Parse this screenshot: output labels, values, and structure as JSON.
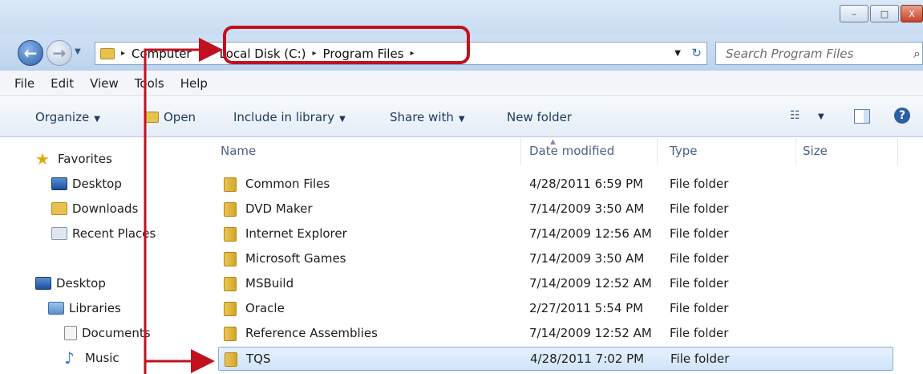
{
  "window": {
    "minimize_glyph": "–",
    "maximize_glyph": "□",
    "close_glyph": "X"
  },
  "address": {
    "crumbs": [
      "Computer",
      "Local Disk (C:)",
      "Program Files"
    ],
    "separator": "▸",
    "dropdown_glyph": "▼",
    "refresh_glyph": "↻"
  },
  "search": {
    "placeholder": "Search Program Files",
    "icon_glyph": "⌕"
  },
  "menubar": {
    "items": [
      "File",
      "Edit",
      "View",
      "Tools",
      "Help"
    ]
  },
  "toolbar": {
    "organize": "Organize",
    "open": "Open",
    "include_in_library": "Include in library",
    "share_with": "Share with",
    "new_folder": "New folder",
    "caret": "▼",
    "views_glyph": "☷",
    "help_glyph": "?"
  },
  "navpane": {
    "favorites_label": "Favorites",
    "star_glyph": "★",
    "music_glyph": "♪",
    "items": [
      {
        "label": "Desktop"
      },
      {
        "label": "Downloads"
      },
      {
        "label": "Recent Places"
      },
      {
        "label": "Desktop"
      },
      {
        "label": "Libraries"
      },
      {
        "label": "Documents"
      },
      {
        "label": "Music"
      }
    ]
  },
  "columns": {
    "name": "Name",
    "date": "Date modified",
    "type": "Type",
    "size": "Size",
    "sort_glyph": "▲"
  },
  "files": [
    {
      "name": "Common Files",
      "date": "4/28/2011 6:59 PM",
      "type": "File folder"
    },
    {
      "name": "DVD Maker",
      "date": "7/14/2009 3:50 AM",
      "type": "File folder"
    },
    {
      "name": "Internet Explorer",
      "date": "7/14/2009 12:56 AM",
      "type": "File folder"
    },
    {
      "name": "Microsoft Games",
      "date": "7/14/2009 3:50 AM",
      "type": "File folder"
    },
    {
      "name": "MSBuild",
      "date": "7/14/2009 12:52 AM",
      "type": "File folder"
    },
    {
      "name": "Oracle",
      "date": "2/27/2011 5:54 PM",
      "type": "File folder"
    },
    {
      "name": "Reference Assemblies",
      "date": "7/14/2009 12:52 AM",
      "type": "File folder"
    },
    {
      "name": "TQS",
      "date": "4/28/2011 7:02 PM",
      "type": "File folder",
      "selected": true
    }
  ],
  "annotation": {
    "color": "#c0111f"
  }
}
